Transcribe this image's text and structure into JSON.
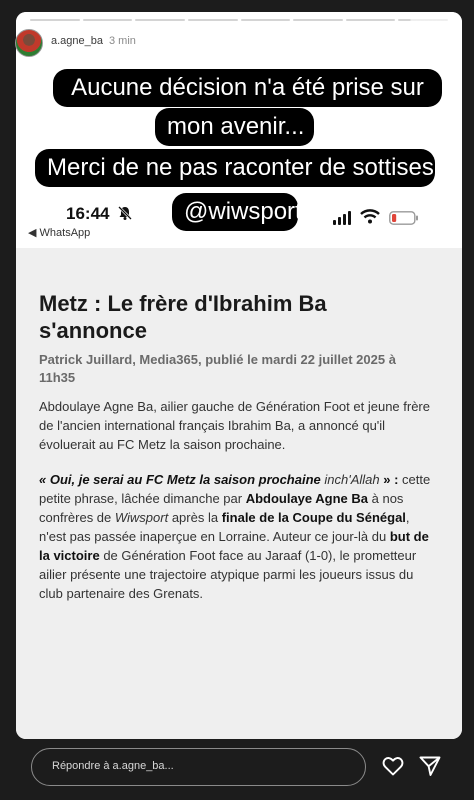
{
  "story": {
    "username": "a.agne_ba",
    "time_ago": "3 min",
    "segments": 8,
    "current_segment_progress": 0.25,
    "captions": [
      "Aucune décision n'a été prise sur",
      "mon avenir...",
      "Merci de ne pas raconter de sottises",
      "@wiwsport"
    ]
  },
  "screenshot": {
    "status_time": "16:44",
    "back_label": "◀ WhatsApp",
    "battery_level": 0.2,
    "battery_color": "#e0453a"
  },
  "article": {
    "title": "Metz : Le frère d'Ibrahim Ba s'annonce",
    "byline": "Patrick Juillard, Media365, publié le mardi 22 juillet 2025 à 11h35",
    "intro": "Abdoulaye Agne Ba, ailier gauche de Génération Foot et jeune frère de l'ancien international français Ibrahim Ba, a annoncé qu'il évoluerait au FC Metz la saison prochaine.",
    "body": {
      "quote": "« Oui, je serai au FC Metz la saison prochaine",
      "quote_inchallah": "inch'Allah",
      "quote_end": "» :",
      "text1": " cette petite phrase, lâchée dimanche par ",
      "player": "Abdoulaye Agne Ba",
      "text2": " à nos confrères de ",
      "media": "Wiwsport",
      "text3": " après la ",
      "final": "finale de la Coupe du Sénégal",
      "text4": ", n'est pas passée inaperçue en Lorraine. Auteur ce jour-là du ",
      "goal": "but de la victoire",
      "text5": " de Génération Foot face au Jaraaf (1-0), le prometteur ailier présente une trajectoire atypique parmi les joueurs issus du club partenaire des Grenats."
    }
  },
  "reply": {
    "placeholder": "Répondre à a.agne_ba..."
  },
  "icons": [
    "pause-icon",
    "more-icon",
    "silent-bell-icon",
    "signal-icon",
    "wifi-icon",
    "battery-icon",
    "heart-icon",
    "send-icon"
  ]
}
